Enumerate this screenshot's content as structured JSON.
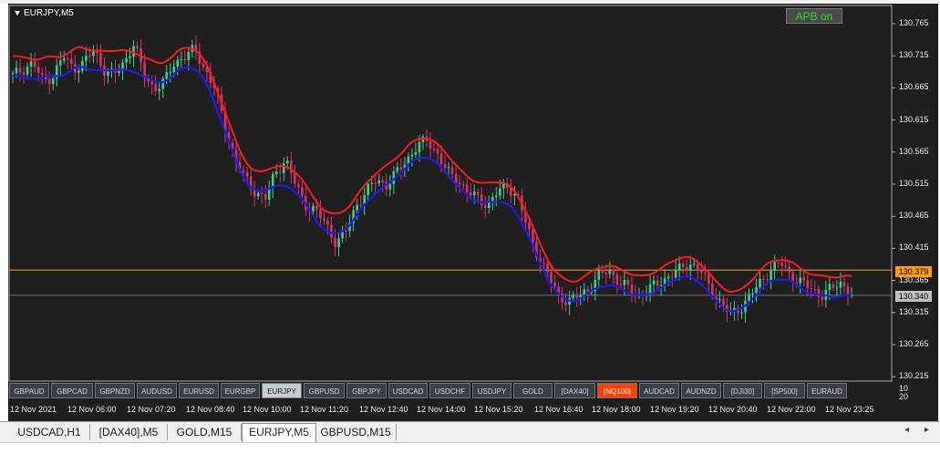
{
  "window": {
    "symbol_title": "EURJPY,M5",
    "apb_button": "APB on"
  },
  "price_axis": {
    "labels": [
      "130.765",
      "130.715",
      "130.665",
      "130.615",
      "130.565",
      "130.515",
      "130.465",
      "130.415",
      "130.365",
      "130.315",
      "130.265",
      "130.215"
    ],
    "current_orange": "130.379",
    "current_gray": "130.340",
    "sub_top": "10",
    "sub_bottom": "20"
  },
  "time_axis": {
    "labels": [
      "12 Nov 2021",
      "12 Nov 06:00",
      "12 Nov 07:20",
      "12 Nov 08:40",
      "12 Nov 10:00",
      "12 Nov 11:20",
      "12 Nov 12:40",
      "12 Nov 14:00",
      "12 Nov 15:20",
      "12 Nov 16:40",
      "12 Nov 18:00",
      "12 Nov 19:20",
      "12 Nov 20:40",
      "12 Nov 22:00",
      "12 Nov 23:25"
    ]
  },
  "symbol_buttons": [
    {
      "label": "GBPAUD",
      "state": "normal"
    },
    {
      "label": "GBPCAD",
      "state": "normal"
    },
    {
      "label": "GBPNZD",
      "state": "normal"
    },
    {
      "label": "AUDUSD",
      "state": "normal"
    },
    {
      "label": "EURUSD",
      "state": "normal"
    },
    {
      "label": "EURGBP",
      "state": "normal"
    },
    {
      "label": "EURJPY",
      "state": "active"
    },
    {
      "label": "GBPUSD",
      "state": "normal"
    },
    {
      "label": "GBPJPY",
      "state": "normal"
    },
    {
      "label": "USDCAD",
      "state": "normal"
    },
    {
      "label": "USDCHF",
      "state": "normal"
    },
    {
      "label": "USDJPY",
      "state": "normal"
    },
    {
      "label": "GOLD",
      "state": "normal"
    },
    {
      "label": "[DAX40]",
      "state": "normal"
    },
    {
      "label": "[NQ100]",
      "state": "alert"
    },
    {
      "label": "AUDCAD",
      "state": "normal"
    },
    {
      "label": "AUDNZD",
      "state": "normal"
    },
    {
      "label": "[DJI30]",
      "state": "normal"
    },
    {
      "label": "[SP500]",
      "state": "normal"
    },
    {
      "label": "EURAUD",
      "state": "normal"
    }
  ],
  "tabs": [
    {
      "label": "USDCAD,H1",
      "active": false
    },
    {
      "label": "[DAX40],M5",
      "active": false
    },
    {
      "label": "GOLD,M15",
      "active": false
    },
    {
      "label": "EURJPY,M5",
      "active": true
    },
    {
      "label": "GBPUSD,M15",
      "active": false
    }
  ],
  "icons": {
    "scroll_left": "triangle-left-icon",
    "scroll_right": "triangle-right-icon"
  },
  "colors": {
    "chart_bg": "#1f1f1f",
    "bull_candle": "#3dcf8a",
    "bear_candle": "#d6336c",
    "upper_line": "#ff1a1a",
    "lower_line": "#1a1aff",
    "orange_level": "#ff9a1a",
    "apb_text": "#22e022",
    "alert_button": "#ff4000"
  },
  "chart_data": {
    "type": "candlestick",
    "y_range": [
      130.21,
      130.78
    ],
    "price_levels": [
      130.379,
      130.34
    ],
    "series": [
      {
        "values": [
          130.68,
          130.69,
          130.7,
          130.67,
          130.68,
          130.71,
          130.69,
          130.7,
          130.72,
          130.69,
          130.68,
          130.7,
          130.73,
          130.68,
          130.66,
          130.67,
          130.7,
          130.71,
          130.72,
          130.69,
          130.66,
          130.6,
          130.55,
          130.52,
          130.5,
          130.49,
          130.53,
          130.55,
          130.51,
          130.48,
          130.47,
          130.45,
          130.42,
          130.44,
          130.48,
          130.5,
          130.52,
          130.51,
          130.53,
          130.55,
          130.57,
          130.58,
          130.56,
          130.53,
          130.52,
          130.5,
          130.49,
          130.48,
          130.5,
          130.51,
          130.49,
          130.44,
          130.4,
          130.37,
          130.34,
          130.33,
          130.34,
          130.35,
          130.37,
          130.38,
          130.36,
          130.35,
          130.34,
          130.35,
          130.36,
          130.37,
          130.38,
          130.39,
          130.38,
          130.35,
          130.33,
          130.31,
          130.32,
          130.34,
          130.36,
          130.38,
          130.39,
          130.37,
          130.36,
          130.35,
          130.34,
          130.35,
          130.36,
          130.34
        ]
      }
    ]
  }
}
